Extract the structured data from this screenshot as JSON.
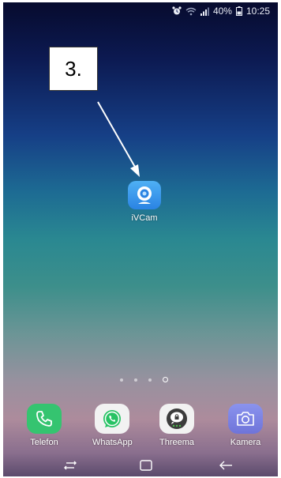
{
  "status_bar": {
    "battery_percent": "40%",
    "time": "10:25",
    "icons": [
      "alarm-icon",
      "wifi-icon",
      "signal-icon",
      "battery-icon"
    ]
  },
  "annotation": {
    "step_label": "3."
  },
  "home_screen": {
    "apps": [
      {
        "label": "iVCam",
        "icon": "ivcam-webcam-icon",
        "color": "#3a9bef"
      }
    ],
    "page_indicator": {
      "pages": 4,
      "current": "home"
    }
  },
  "dock": {
    "apps": [
      {
        "label": "Telefon",
        "icon": "phone-icon",
        "color": "#35c470"
      },
      {
        "label": "WhatsApp",
        "icon": "whatsapp-icon",
        "color": "#f2f2f2"
      },
      {
        "label": "Threema",
        "icon": "threema-icon",
        "color": "#f2f2f2"
      },
      {
        "label": "Kamera",
        "icon": "camera-icon",
        "color": "#7b86e8"
      }
    ]
  },
  "navigation_bar": {
    "buttons": [
      "recents-button",
      "home-button",
      "back-button"
    ]
  }
}
